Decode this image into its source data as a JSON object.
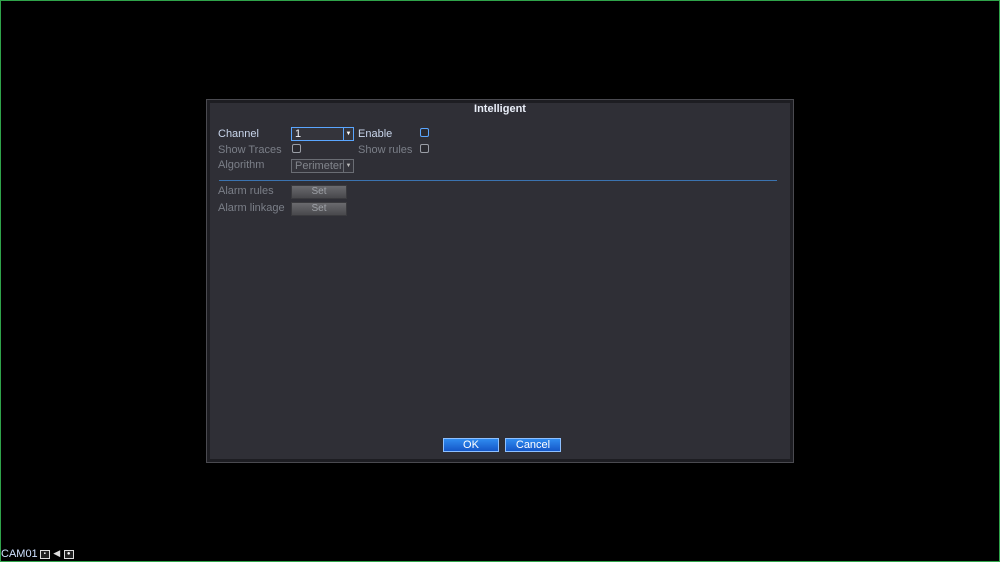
{
  "dialog": {
    "title": "Intelligent",
    "channel": {
      "label": "Channel",
      "value": "1"
    },
    "enable": {
      "label": "Enable",
      "checked": false
    },
    "show_traces": {
      "label": "Show Traces",
      "checked": false
    },
    "show_rules": {
      "label": "Show rules",
      "checked": false
    },
    "algorithm": {
      "label": "Algorithm",
      "value": "Perimeter"
    },
    "alarm_rules": {
      "label": "Alarm rules",
      "button": "Set"
    },
    "alarm_linkage": {
      "label": "Alarm linkage",
      "button": "Set"
    },
    "ok_label": "OK",
    "cancel_label": "Cancel"
  },
  "status_bar": {
    "camera_name": "CAM01",
    "icons": [
      "recording-icon",
      "audio-icon",
      "camera-icon"
    ]
  },
  "colors": {
    "accent": "#2f8cf0",
    "dialog_bg": "#2f2f36",
    "frame_border": "#2fa34a"
  }
}
